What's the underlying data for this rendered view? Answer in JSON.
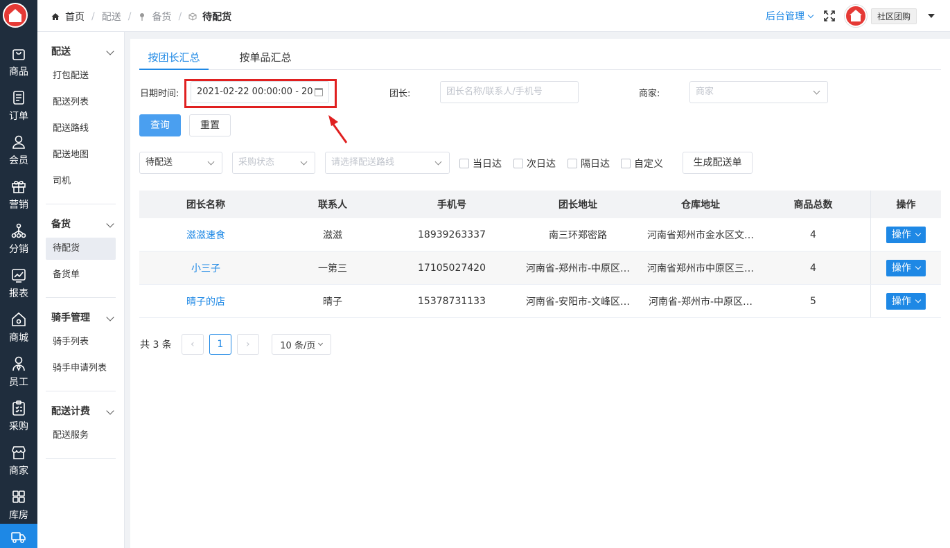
{
  "rail": {
    "items": [
      {
        "label": "商品",
        "icon": "shopping-bag-icon"
      },
      {
        "label": "订单",
        "icon": "order-icon"
      },
      {
        "label": "会员",
        "icon": "user-icon"
      },
      {
        "label": "营销",
        "icon": "gift-icon"
      },
      {
        "label": "分销",
        "icon": "distribution-icon"
      },
      {
        "label": "报表",
        "icon": "chart-icon"
      },
      {
        "label": "商城",
        "icon": "home-icon"
      },
      {
        "label": "员工",
        "icon": "staff-icon"
      },
      {
        "label": "采购",
        "icon": "clipboard-icon"
      },
      {
        "label": "商家",
        "icon": "store-icon"
      },
      {
        "label": "库房",
        "icon": "warehouse-icon"
      },
      {
        "label": "",
        "icon": "truck-icon"
      }
    ]
  },
  "submenu": {
    "groups": [
      {
        "title": "配送",
        "items": [
          "打包配送",
          "配送列表",
          "配送路线",
          "配送地图",
          "司机"
        ]
      },
      {
        "title": "备货",
        "items": [
          "待配货",
          "备货单"
        ]
      },
      {
        "title": "骑手管理",
        "items": [
          "骑手列表",
          "骑手申请列表"
        ]
      },
      {
        "title": "配送计费",
        "items": [
          "配送服务"
        ]
      }
    ]
  },
  "header": {
    "breadcrumb": [
      "首页",
      "配送",
      "备货",
      "待配货"
    ],
    "admin_label": "后台管理",
    "shop_tag": "社区团购"
  },
  "tabs": [
    "按团长汇总",
    "按单品汇总"
  ],
  "filters": {
    "date_label": "日期时间:",
    "date_value": "2021-02-22 00:00:00 - 20",
    "leader_label": "团长:",
    "leader_placeholder": "团长名称/联系人/手机号",
    "merchant_label": "商家:",
    "merchant_placeholder": "商家",
    "query_btn": "查询",
    "reset_btn": "重置",
    "status_value": "待配送",
    "purchase_placeholder": "采购状态",
    "route_placeholder": "请选择配送路线",
    "checkboxes": [
      "当日达",
      "次日达",
      "隔日达",
      "自定义"
    ],
    "generate_btn": "生成配送单"
  },
  "table": {
    "columns": [
      "团长名称",
      "联系人",
      "手机号",
      "团长地址",
      "仓库地址",
      "商品总数",
      "操作"
    ],
    "rows": [
      {
        "name": "滋滋速食",
        "contact": "滋滋",
        "phone": "18939263337",
        "address": "南三环郑密路",
        "warehouse": "河南省郑州市金水区文…",
        "total": "4",
        "op": "操作"
      },
      {
        "name": "小三子",
        "contact": "一第三",
        "phone": "17105027420",
        "address": "河南省-郑州市-中原区…",
        "warehouse": "河南省郑州市中原区三…",
        "total": "4",
        "op": "操作"
      },
      {
        "name": "晴子的店",
        "contact": "晴子",
        "phone": "15378731133",
        "address": "河南省-安阳市-文峰区…",
        "warehouse": "河南省-郑州市-中原区…",
        "total": "5",
        "op": "操作"
      }
    ]
  },
  "pager": {
    "total_text": "共 3 条",
    "prev": "‹",
    "page": "1",
    "next": "›",
    "size": "10 条/页"
  }
}
